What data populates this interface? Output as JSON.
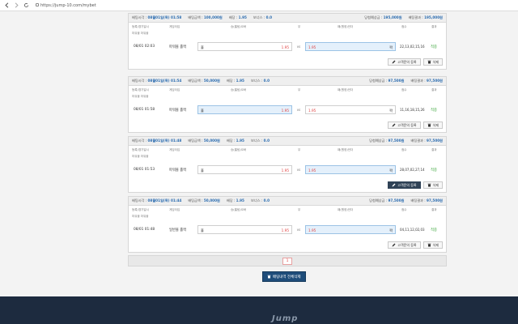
{
  "browser": {
    "url": "https://jump-10.com/mybet"
  },
  "labels": {
    "bet_time": "배팅시각 :",
    "bet_amount": "배팅금액 :",
    "odds": "배당 :",
    "bonus": "보너스 :",
    "expected": "당첨예상금 :",
    "result": "배팅결과 :",
    "col_date": "등록/경기일시",
    "col_game": "게임타입",
    "col_home": "승(홈팀)오버",
    "col_draw": "무",
    "col_away": "패(원정)언더",
    "col_score": "점수",
    "col_result": "결과",
    "vs": "vs",
    "post_button": "고객문의 등록",
    "delete_button": "삭제"
  },
  "cards": [
    {
      "bet_time": "08월01일(목) 01:58",
      "bet_amount": "100,000원",
      "odds": "1.95",
      "bonus": "0.0",
      "expected": "195,000원",
      "result_amount": "195,000원",
      "sub_label": "파워볼 파워볼",
      "time": "08/01 02:03",
      "game": "파워볼 홀짝",
      "home": "홀",
      "home_odds": "1.95",
      "away_odds": "1.95",
      "away": "짝",
      "score": "22,13,02,15,16",
      "result": "적중",
      "selected": "away"
    },
    {
      "bet_time": "08월01일(목) 01:54",
      "bet_amount": "50,000원",
      "odds": "1.95",
      "bonus": "0.0",
      "expected": "97,500원",
      "result_amount": "97,500원",
      "sub_label": "파워볼 파워볼",
      "time": "08/01 01:58",
      "game": "파워볼 홀짝",
      "home": "홀",
      "home_odds": "1.95",
      "away_odds": "1.95",
      "away": "짝",
      "score": "11,16,18,15,26",
      "result": "적중",
      "selected": "home"
    },
    {
      "bet_time": "08월01일(목) 01:48",
      "bet_amount": "50,000원",
      "odds": "1.95",
      "bonus": "0.0",
      "expected": "97,500원",
      "result_amount": "97,500원",
      "sub_label": "파워볼 파워볼",
      "time": "08/01 01:53",
      "game": "파워볼 홀짝",
      "home": "홀",
      "home_odds": "1.95",
      "away_odds": "1.95",
      "away": "짝",
      "score": "28,07,02,27,14",
      "result": "적중",
      "selected": "away"
    },
    {
      "bet_time": "08월01일(목) 01:44",
      "bet_amount": "50,000원",
      "odds": "1.95",
      "bonus": "0.0",
      "expected": "97,500원",
      "result_amount": "97,500원",
      "sub_label": "파워볼 파워볼",
      "time": "08/01 01:48",
      "game": "일반볼 홀짝",
      "home": "홀",
      "home_odds": "1.95",
      "away_odds": "1.95",
      "away": "짝",
      "score": "04,11,12,02,03",
      "result": "적중",
      "selected": "away"
    }
  ],
  "pagination": {
    "current": "1"
  },
  "delete_all": "배팅내역 전체삭제",
  "footer": {
    "logo": "Jump"
  },
  "colors": {
    "accent": "#2b6cb0",
    "win": "#35a335",
    "odds": "#e04040",
    "footer": "#1d2b3f"
  }
}
